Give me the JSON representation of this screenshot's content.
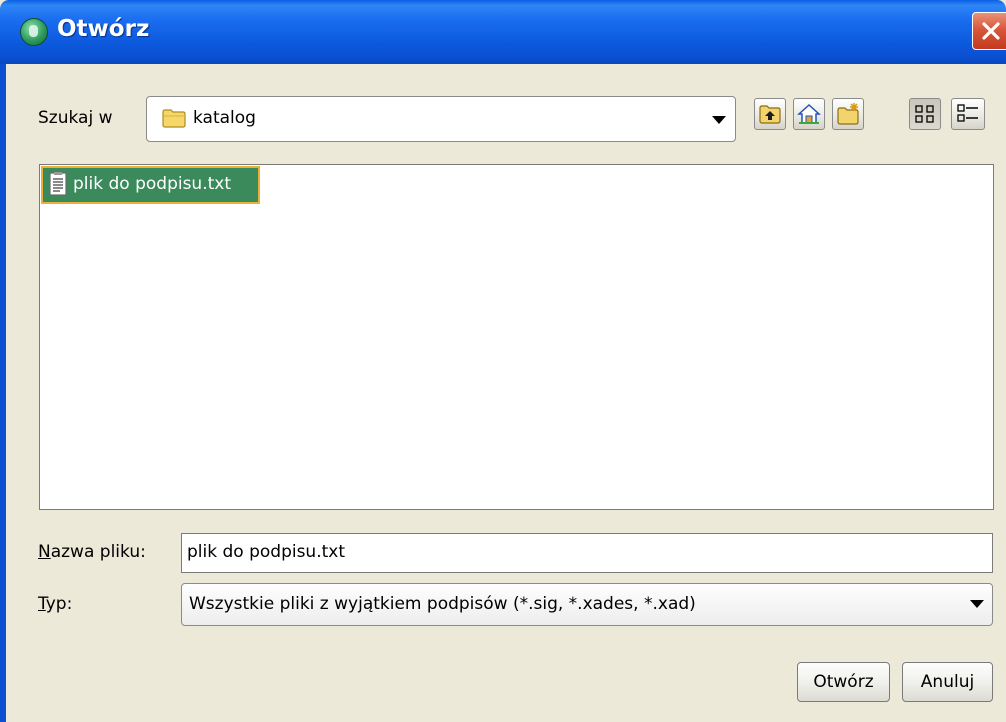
{
  "window": {
    "title": "Otwórz"
  },
  "look_in": {
    "label": "Szukaj w",
    "value": "katalog"
  },
  "toolbar": {
    "buttons": [
      {
        "name": "up-one-level",
        "icon": "folder-up-icon"
      },
      {
        "name": "home",
        "icon": "home-icon"
      },
      {
        "name": "new-folder",
        "icon": "new-folder-icon"
      },
      {
        "name": "list-view",
        "icon": "list-view-icon",
        "pressed": true
      },
      {
        "name": "details-view",
        "icon": "details-view-icon"
      }
    ]
  },
  "files": [
    {
      "name": "plik do podpisu.txt",
      "icon": "text-file-icon",
      "selected": true
    }
  ],
  "form": {
    "filename_label_u": "N",
    "filename_label_rest": "azwa pliku:",
    "filename_value": "plik do podpisu.txt",
    "type_label_u": "T",
    "type_label_rest": "yp:",
    "type_value": "Wszystkie pliki z wyjątkiem podpisów (*.sig, *.xades, *.xad)"
  },
  "buttons": {
    "open": "Otwórz",
    "cancel": "Anuluj"
  },
  "colors": {
    "titlebar": "#0a5ee6",
    "selection": "#3a8a5c",
    "selection_border": "#e8b13a",
    "background": "#ece9d8"
  }
}
